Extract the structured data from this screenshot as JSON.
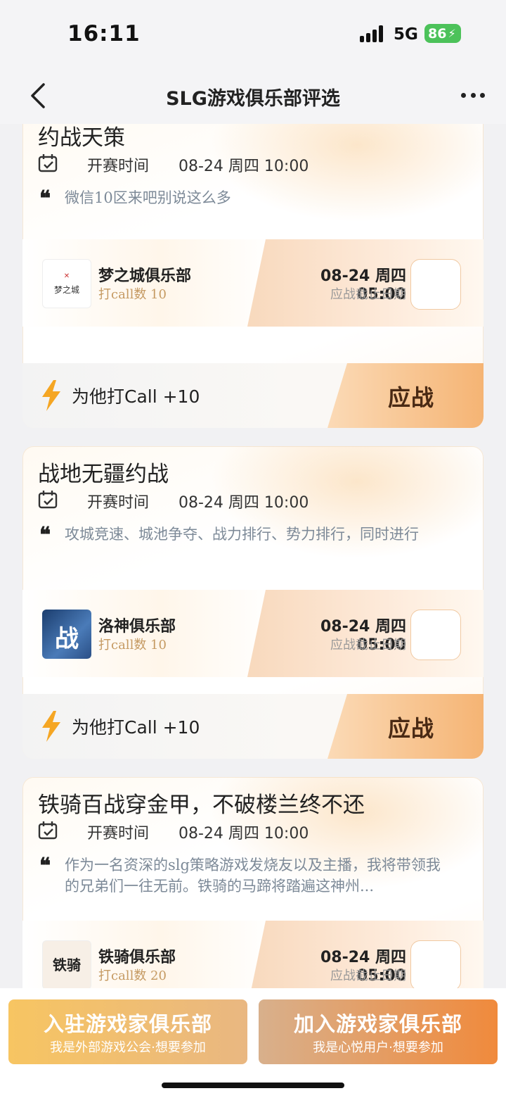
{
  "status_bar": {
    "time": "16:11",
    "network": "5G",
    "battery": "86"
  },
  "nav": {
    "title": "SLG游戏俱乐部评选"
  },
  "cards": [
    {
      "title": "约战天策",
      "time_label": "开赛时间",
      "time_value": "08-24 周四 10:00",
      "description": "微信10区来吧别说这么多",
      "club": {
        "name": "梦之城俱乐部",
        "call": "打call数 10",
        "logo_text": "梦之城",
        "deadline": "08-24 周四 05:00",
        "deadline_label": "应战截止日期"
      },
      "action": {
        "call_label": "为他打Call +10",
        "fight_label": "应战"
      }
    },
    {
      "title": "战地无疆约战",
      "time_label": "开赛时间",
      "time_value": "08-24 周四 10:00",
      "description": "攻城竞速、城池争夺、战力排行、势力排行，同时进行",
      "club": {
        "name": "洛神俱乐部",
        "call": "打call数 10",
        "logo_text": "战",
        "deadline": "08-24 周四 05:00",
        "deadline_label": "应战截止日期"
      },
      "action": {
        "call_label": "为他打Call +10",
        "fight_label": "应战"
      }
    },
    {
      "title": "铁骑百战穿金甲，不破楼兰终不还",
      "time_label": "开赛时间",
      "time_value": "08-24 周四 10:00",
      "description": "作为一名资深的slg策略游戏发烧友以及主播，我将带领我的兄弟们一往无前。铁骑的马蹄将踏遍这神州...",
      "club": {
        "name": "铁骑俱乐部",
        "call": "打call数 20",
        "logo_text": "铁骑",
        "deadline": "08-24 周四 05:00",
        "deadline_label": "应战截止日期"
      }
    }
  ],
  "bottom": {
    "left_title": "入驻游戏家俱乐部",
    "left_sub": "我是外部游戏公会·想要参加",
    "right_title": "加入游戏家俱乐部",
    "right_sub": "我是心悦用户·想要参加"
  },
  "colors": {
    "accent": "#f5b474",
    "call_text": "#c59a62",
    "quote_text": "#7d8a98"
  }
}
